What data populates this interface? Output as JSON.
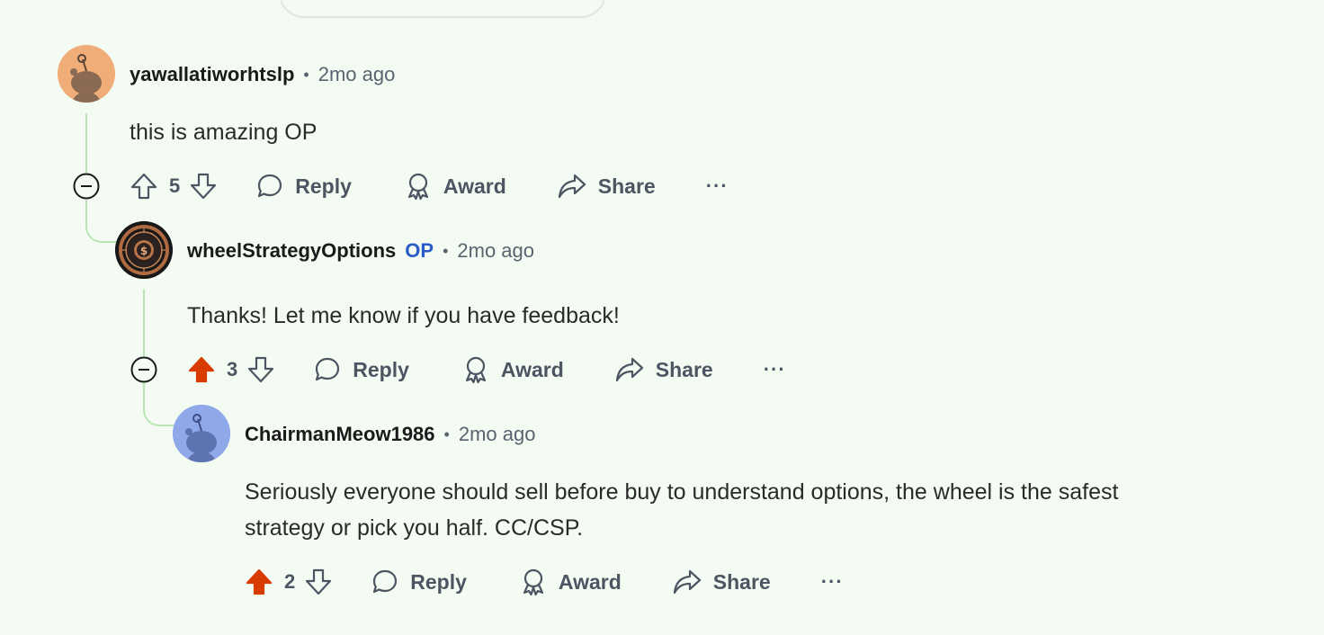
{
  "comments": [
    {
      "username": "yawallatiworhtslp",
      "time": "2mo ago",
      "body": "this is amazing OP",
      "votes": "5",
      "upvoted": false,
      "reply_label": "Reply",
      "award_label": "Award",
      "share_label": "Share",
      "more_label": "···",
      "avatar_color": "#f0ad77"
    },
    {
      "username": "wheelStrategyOptions",
      "op_badge": "OP",
      "time": "2mo ago",
      "body": "Thanks! Let me know if you have feedback!",
      "votes": "3",
      "upvoted": true,
      "reply_label": "Reply",
      "award_label": "Award",
      "share_label": "Share",
      "more_label": "···",
      "avatar_logo_text": "WHEEL STRATEGY OPTIONS"
    },
    {
      "username": "ChairmanMeow1986",
      "time": "2mo ago",
      "body_line1": "Seriously everyone should sell before buy to understand options, the wheel is the safest",
      "body_line2": "strategy or pick you half. CC/CSP.",
      "votes": "2",
      "upvoted": true,
      "reply_label": "Reply",
      "award_label": "Award",
      "share_label": "Share",
      "more_label": "···",
      "avatar_color": "#8fa8ea"
    }
  ],
  "colors": {
    "background": "#f4fbf3",
    "upvote_active": "#d93a00",
    "thread_line": "#b8e6b3",
    "op_badge": "#2a5cc7"
  }
}
